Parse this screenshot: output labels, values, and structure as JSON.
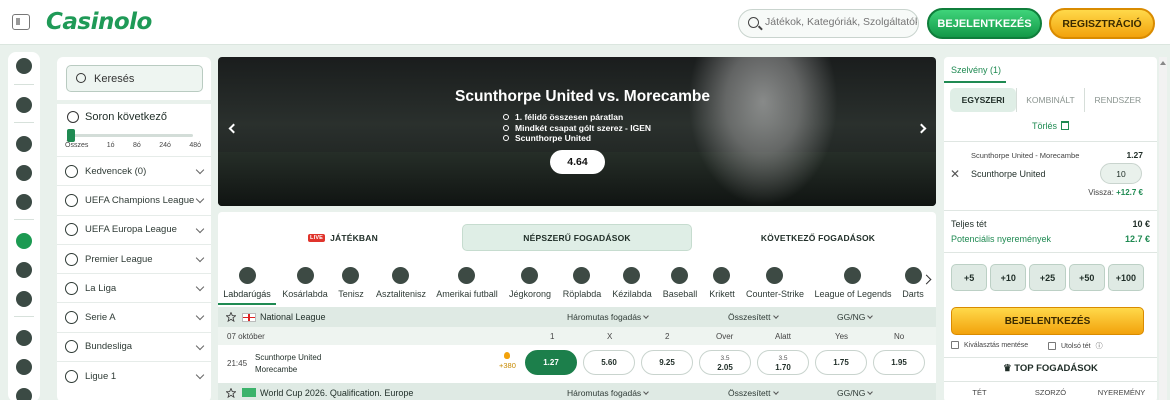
{
  "topbar": {
    "logo": "Casinolo",
    "search_placeholder": "Játékok, Kategóriák, Szolgáltatók",
    "login": "BEJELENTKEZÉS",
    "register": "REGISZTRÁCIÓ"
  },
  "sidebar": {
    "search_placeholder": "Keresés",
    "next_title": "Soron következő",
    "slider_labels": [
      "Összes",
      "1ó",
      "8ó",
      "24ó",
      "48ó"
    ],
    "slider_value": "Összes",
    "items": [
      {
        "label": "Kedvencek (0)",
        "icon": "star-icon"
      },
      {
        "label": "UEFA Champions League",
        "icon": "ball-icon"
      },
      {
        "label": "UEFA Europa League",
        "icon": "globe-icon"
      },
      {
        "label": "Premier League",
        "icon": "lion-icon"
      },
      {
        "label": "La Liga",
        "icon": "laliga-icon"
      },
      {
        "label": "Serie A",
        "icon": "seriea-icon"
      },
      {
        "label": "Bundesliga",
        "icon": "bundesliga-icon"
      },
      {
        "label": "Ligue 1",
        "icon": "ligue1-icon"
      }
    ]
  },
  "hero": {
    "title": "Scunthorpe United vs. Morecambe",
    "legs": [
      "1. félidő összesen páratlan",
      "Mindkét csapat gólt szerez - IGEN",
      "Scunthorpe United"
    ],
    "odds": "4.64"
  },
  "tabs": {
    "live_badge": "LIVE",
    "live": "JÁTÉKBAN",
    "popular": "NÉPSZERŰ FOGADÁSOK",
    "next": "KÖVETKEZŐ FOGADÁSOK",
    "active": "NÉPSZERŰ FOGADÁSOK"
  },
  "sports": [
    "Labdarúgás",
    "Kosárlabda",
    "Tenisz",
    "Asztalitenisz",
    "Amerikai futball",
    "Jégkorong",
    "Röplabda",
    "Kézilabda",
    "Baseball",
    "Krikett",
    "Counter-Strike",
    "League of Legends",
    "Darts"
  ],
  "active_sport": "Labdarúgás",
  "league": {
    "name": "National League",
    "market1": "Háromutas fogadás",
    "market2": "Összesített",
    "market3": "GG/NG",
    "date": "07 október",
    "cols": [
      "1",
      "X",
      "2",
      "Over",
      "Alatt",
      "Yes",
      "No"
    ]
  },
  "match": {
    "time": "21:45",
    "home": "Scunthorpe United",
    "away": "Morecambe",
    "more": "+380",
    "odds": [
      {
        "top": "",
        "val": "1.27",
        "selected": true
      },
      {
        "top": "",
        "val": "5.60"
      },
      {
        "top": "",
        "val": "9.25"
      },
      {
        "top": "3.5",
        "val": "2.05"
      },
      {
        "top": "3.5",
        "val": "1.70"
      },
      {
        "top": "",
        "val": "1.75"
      },
      {
        "top": "",
        "val": "1.95"
      }
    ]
  },
  "league2": {
    "name": "World Cup 2026. Qualification. Europe",
    "market1": "Háromutas fogadás",
    "market2": "Összesített",
    "market3": "GG/NG"
  },
  "slip": {
    "title": "Szelvény (1)",
    "tabs": [
      "EGYSZERI",
      "KOMBINÁLT",
      "RENDSZER"
    ],
    "clear": "Törlés",
    "match": "Scunthorpe United - Morecambe",
    "odd": "1.27",
    "team": "Scunthorpe United",
    "stake": "10",
    "return_label": "Vissza:",
    "return_value": "+12.7 €",
    "total_label": "Teljes tét",
    "total_value": "10 €",
    "pot_label": "Potenciális nyeremények",
    "pot_value": "12.7 €",
    "quick": [
      "+5",
      "+10",
      "+25",
      "+50",
      "+100"
    ],
    "login": "BEJELENTKEZÉS",
    "save_selection": "Kiválasztás mentése",
    "last_bet": "Utolsó tét",
    "top_bets": "TOP FOGADÁSOK",
    "top_cols": [
      "TÉT",
      "SZORZÓ",
      "NYEREMÉNY"
    ]
  }
}
